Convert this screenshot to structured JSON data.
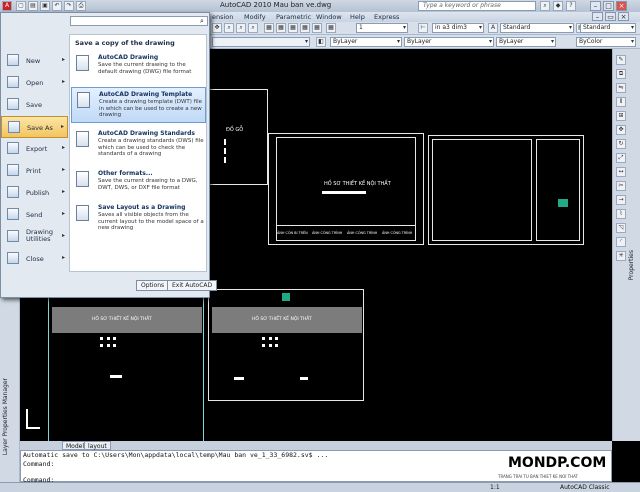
{
  "window": {
    "title": "AutoCAD 2010     Mau ban ve.dwg",
    "search_placeholder": "Type a keyword or phrase"
  },
  "menubar": [
    "ension",
    "Modify",
    "Parametric",
    "Window",
    "Help",
    "Express"
  ],
  "toolbar": {
    "zoom_value": "1",
    "dimstyle": "in a3 dim3",
    "textstyle": "Standard",
    "plotstyle": "Standard"
  },
  "properties_bar": {
    "layer": "ByLayer",
    "linetype": "ByLayer",
    "lineweight": "ByLayer",
    "color": "ByColor"
  },
  "app_menu": {
    "items": [
      {
        "label": "New",
        "has_submenu": true
      },
      {
        "label": "Open",
        "has_submenu": true
      },
      {
        "label": "Save",
        "has_submenu": false
      },
      {
        "label": "Save As",
        "has_submenu": true
      },
      {
        "label": "Export",
        "has_submenu": true
      },
      {
        "label": "Print",
        "has_submenu": true
      },
      {
        "label": "Publish",
        "has_submenu": true
      },
      {
        "label": "Send",
        "has_submenu": true
      },
      {
        "label": "Drawing\nUtilities",
        "has_submenu": true
      },
      {
        "label": "Close",
        "has_submenu": true
      }
    ],
    "selected_index": 3,
    "panel_heading": "Save a copy of the drawing",
    "panel_items": [
      {
        "title": "AutoCAD Drawing",
        "desc": "Save the current drawing to the default drawing (DWG) file format",
        "icon": "dwg-file-icon"
      },
      {
        "title": "AutoCAD Drawing Template",
        "desc": "Create a drawing template (DWT) file in which can be used to create a new drawing",
        "icon": "dwt-file-icon"
      },
      {
        "title": "AutoCAD Drawing Standards",
        "desc": "Create a drawing standards (DWS) file which can be used to check the standards of a drawing",
        "icon": "dws-file-icon"
      },
      {
        "title": "Other formats...",
        "desc": "Save the current drawing to a DWG, DWT, DWS, or DXF file format",
        "icon": "other-formats-icon"
      },
      {
        "title": "Save Layout as a Drawing",
        "desc": "Saves all visible objects from the current layout to the model space of a new drawing",
        "icon": "layout-icon"
      }
    ],
    "selected_panel_index": 1,
    "options_label": "Options",
    "exit_label": "Exit AutoCAD"
  },
  "drawing": {
    "title_block_text": "HỒ SƠ THIẾT KẾ NỘI THẤT",
    "sheet_labels": [
      "ẢNH CÔN BI TRÊN",
      "ẢNH CÔNG TRÌNH",
      "ẢNH CÔNG TRÌNH",
      "ẢNH CÔNG TRÌNH"
    ],
    "stamp_text": "ĐỒ GỖ"
  },
  "tabs": [
    "Model",
    "layout"
  ],
  "command_lines": [
    "Automatic save to C:\\Users\\Mon\\appdata\\local\\temp\\Mau ban ve_1_33_6982.sv$ ...",
    "Command:",
    "Command:"
  ],
  "side_panels": {
    "right": "Properties",
    "left": "Layer Properties Manager"
  },
  "status": {
    "scale": "1:1",
    "workspace": "AutoCAD Classic"
  },
  "watermark": {
    "brand": "MONDP.COM",
    "tagline": "TRANG TRAI TU BAN THIET KE NOI THAT"
  }
}
